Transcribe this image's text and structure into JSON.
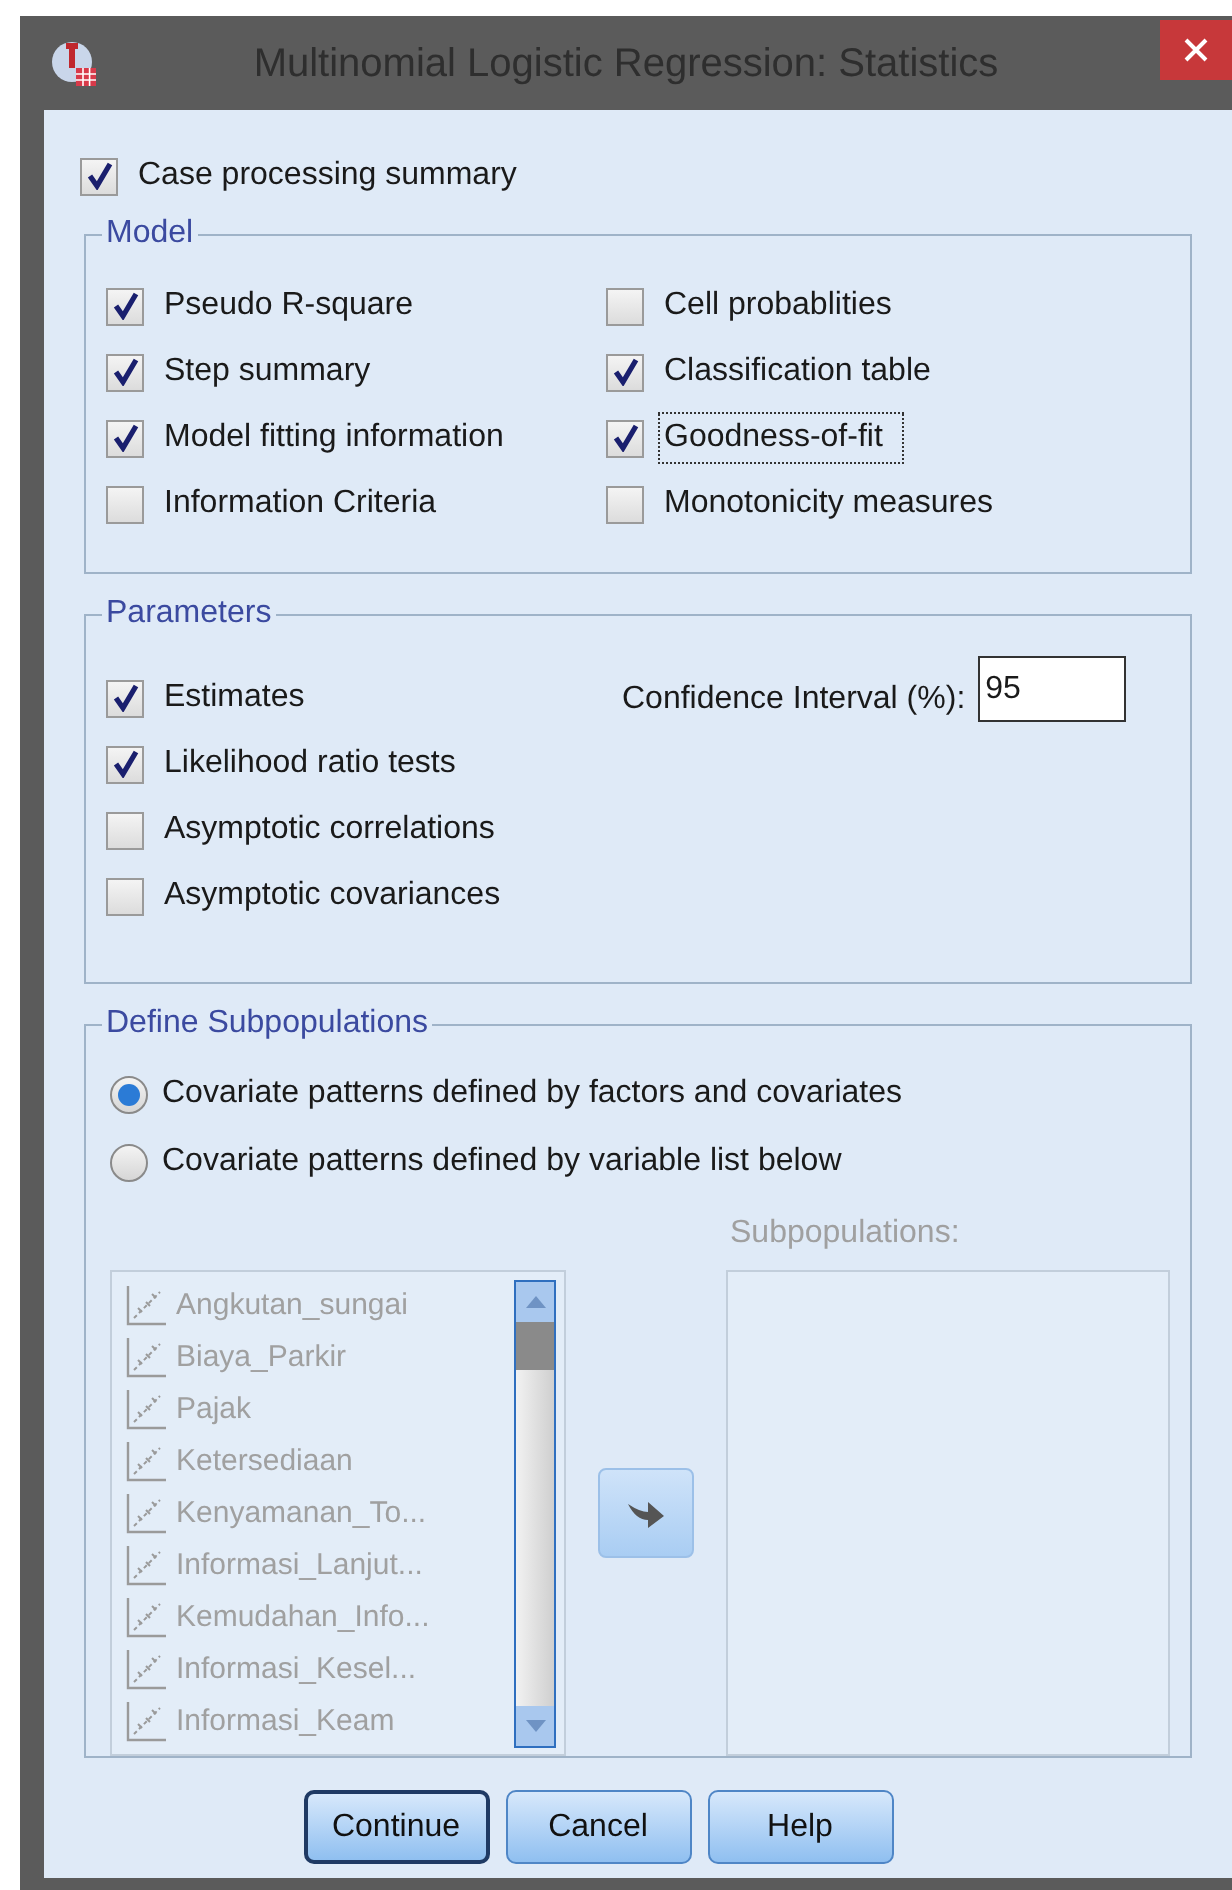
{
  "window": {
    "title": "Multinomial Logistic Regression: Statistics"
  },
  "case_processing_summary": {
    "label": "Case processing summary",
    "checked": true
  },
  "model": {
    "title": "Model",
    "items": [
      {
        "label": "Pseudo R-square",
        "checked": true,
        "focused": false
      },
      {
        "label": "Cell probablities",
        "checked": false,
        "focused": false
      },
      {
        "label": "Step summary",
        "checked": true,
        "focused": false
      },
      {
        "label": "Classification table",
        "checked": true,
        "focused": false
      },
      {
        "label": "Model fitting information",
        "checked": true,
        "focused": false
      },
      {
        "label": "Goodness-of-fit",
        "checked": true,
        "focused": true
      },
      {
        "label": "Information Criteria",
        "checked": false,
        "focused": false
      },
      {
        "label": "Monotonicity measures",
        "checked": false,
        "focused": false
      }
    ]
  },
  "parameters": {
    "title": "Parameters",
    "items": [
      {
        "label": "Estimates",
        "checked": true
      },
      {
        "label": "Likelihood ratio tests",
        "checked": true
      },
      {
        "label": "Asymptotic correlations",
        "checked": false
      },
      {
        "label": "Asymptotic covariances",
        "checked": false
      }
    ],
    "confidence_interval": {
      "label": "Confidence Interval (%):",
      "value": "95"
    }
  },
  "define_subpopulations": {
    "title": "Define Subpopulations",
    "options": [
      {
        "label": "Covariate patterns defined by factors and covariates",
        "selected": true
      },
      {
        "label": "Covariate patterns defined by variable list below",
        "selected": false
      }
    ],
    "variable_list": {
      "disabled": true,
      "items": [
        "Angkutan_sungai",
        "Biaya_Parkir",
        "Pajak",
        "Ketersediaan",
        "Kenyamanan_To...",
        "Informasi_Lanjut...",
        "Kemudahan_Info...",
        "Informasi_Kesel...",
        "Informasi_Keam"
      ]
    },
    "subpopulations": {
      "label": "Subpopulations:",
      "disabled": true
    }
  },
  "buttons": [
    {
      "label": "Continue",
      "default": true
    },
    {
      "label": "Cancel",
      "default": false
    },
    {
      "label": "Help",
      "default": false
    }
  ]
}
